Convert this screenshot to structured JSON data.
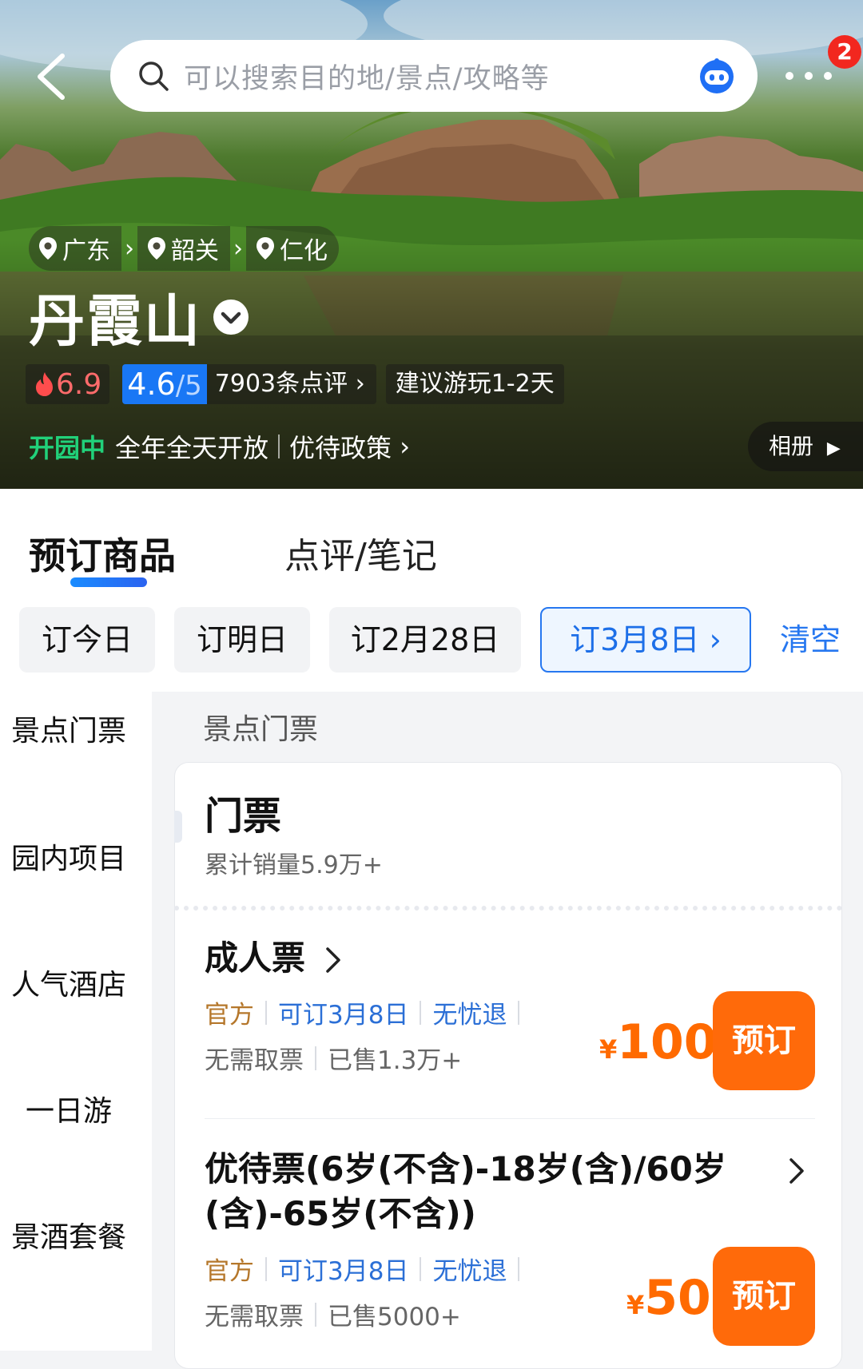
{
  "header": {
    "search_placeholder": "可以搜索目的地/景点/攻略等",
    "notification_count": "2"
  },
  "hero": {
    "breadcrumbs": [
      "广东",
      "韶关",
      "仁化"
    ],
    "title": "丹霞山",
    "heat_score": "6.9",
    "rating": "4.6",
    "rating_denominator": "/5",
    "reviews": "7903条点评",
    "suggested_duration": "建议游玩1-2天",
    "open_status": "开园中",
    "hours": "全年全天开放",
    "policy": "优待政策",
    "album": "相册"
  },
  "tabs": [
    {
      "label": "预订商品",
      "active": true
    },
    {
      "label": "点评/笔记",
      "active": false
    }
  ],
  "date_filters": {
    "chips": [
      "订今日",
      "订明日",
      "订2月28日",
      "订3月8日"
    ],
    "selected_index": 3,
    "clear_label": "清空"
  },
  "sidebar": {
    "items": [
      "景点门票",
      "园内项目",
      "人气酒店",
      "一日游",
      "景酒套餐"
    ]
  },
  "section": {
    "label": "景点门票",
    "card_title": "门票",
    "card_sales": "累计销量5.9万+"
  },
  "tickets": [
    {
      "name": "成人票",
      "tags": [
        "官方",
        "可订3月8日",
        "无忧退"
      ],
      "pickup": "无需取票",
      "sold": "已售1.3万+",
      "currency": "¥",
      "price": "100",
      "book_label": "预订"
    },
    {
      "name_line1": "优待票(6岁(不含)-18岁(含)/60岁",
      "name_line2": "(含)-65岁(不含))",
      "tags": [
        "官方",
        "可订3月8日",
        "无忧退"
      ],
      "pickup": "无需取票",
      "sold": "已售5000+",
      "currency": "¥",
      "price": "50",
      "book_label": "预订"
    }
  ],
  "colors": {
    "accent_blue": "#2677f0",
    "price_orange": "#ff6a00",
    "open_green": "#21d17a",
    "official_tag": "#b5772b"
  }
}
